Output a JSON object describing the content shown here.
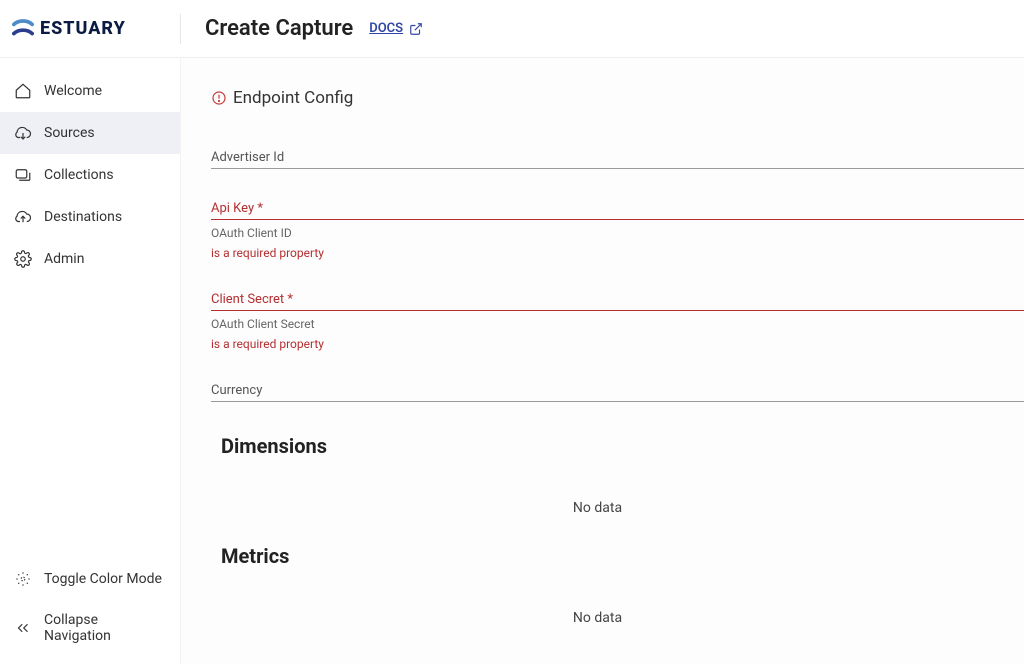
{
  "brand": {
    "name": "ESTUARY"
  },
  "header": {
    "title": "Create Capture",
    "docs_label": "DOCS"
  },
  "sidebar": {
    "items": [
      {
        "label": "Welcome"
      },
      {
        "label": "Sources"
      },
      {
        "label": "Collections"
      },
      {
        "label": "Destinations"
      },
      {
        "label": "Admin"
      }
    ],
    "footer": {
      "toggle_color": "Toggle Color Mode",
      "collapse_nav": "Collapse Navigation"
    }
  },
  "config": {
    "title": "Endpoint Config",
    "fields": {
      "advertiser_id": {
        "label": "Advertiser Id"
      },
      "api_key": {
        "label": "Api Key *",
        "hint": "OAuth Client ID",
        "error": "is a required property"
      },
      "client_secret": {
        "label": "Client Secret *",
        "hint": "OAuth Client Secret",
        "error": "is a required property"
      },
      "currency": {
        "label": "Currency"
      }
    },
    "dimensions": {
      "title": "Dimensions",
      "empty": "No data"
    },
    "metrics": {
      "title": "Metrics",
      "empty": "No data"
    }
  }
}
